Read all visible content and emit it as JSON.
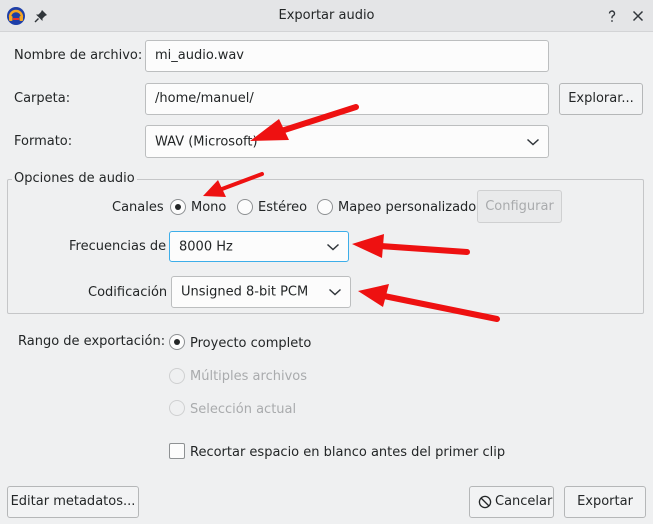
{
  "window": {
    "title": "Exportar audio"
  },
  "file": {
    "name_label": "Nombre de archivo:",
    "name_value": "mi_audio.wav",
    "folder_label": "Carpeta:",
    "folder_value": "/home/manuel/",
    "browse_button": "Explorar...",
    "format_label": "Formato:",
    "format_value": "WAV (Microsoft)"
  },
  "audio_options": {
    "group_title": "Opciones de audio",
    "channels_label": "Canales",
    "channels": [
      {
        "label": "Mono",
        "checked": true
      },
      {
        "label": "Estéreo",
        "checked": false
      },
      {
        "label": "Mapeo personalizado",
        "checked": false
      }
    ],
    "configure_button": "Configurar",
    "sample_rate_label": "Frecuencias de",
    "sample_rate_value": "8000 Hz",
    "encoding_label": "Codificación",
    "encoding_value": "Unsigned 8-bit PCM"
  },
  "export_range": {
    "label": "Rango de exportación:",
    "options": [
      {
        "label": "Proyecto completo",
        "checked": true,
        "enabled": true
      },
      {
        "label": "Múltiples archivos",
        "checked": false,
        "enabled": false
      },
      {
        "label": "Selección actual",
        "checked": false,
        "enabled": false
      }
    ],
    "trim_label": "Recortar espacio en blanco antes del primer clip"
  },
  "footer": {
    "edit_metadata_button": "Editar metadatos...",
    "cancel_button": "Cancelar",
    "export_button": "Exportar"
  },
  "colors": {
    "annotation_arrow": "#ee1111",
    "focus": "#3daee9"
  },
  "icons": {
    "app": "audacity-icon",
    "pin": "pin-icon",
    "help": "help-icon",
    "close": "close-icon",
    "cancel": "cancel-icon"
  }
}
